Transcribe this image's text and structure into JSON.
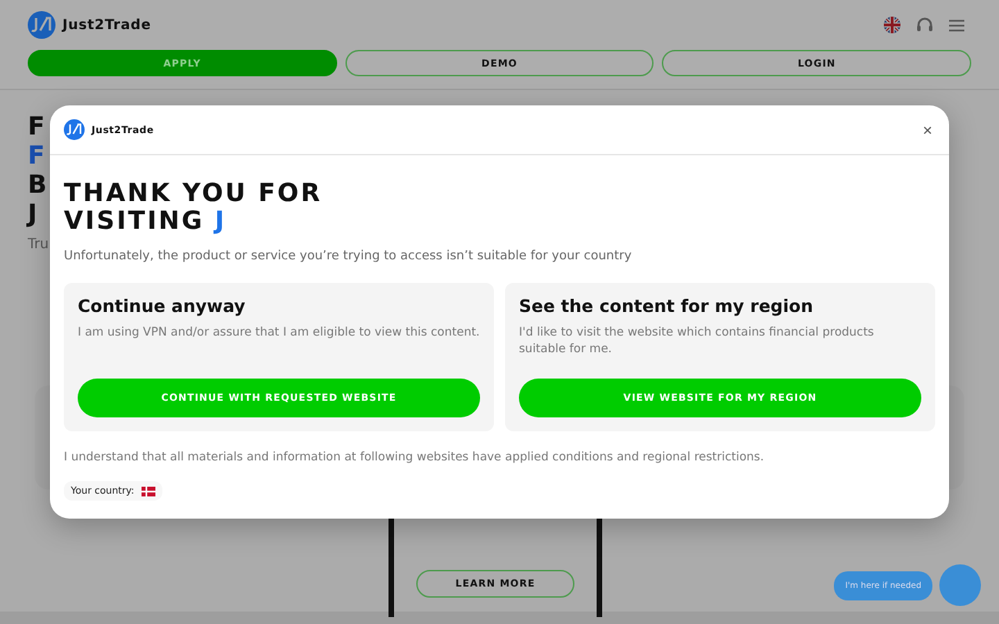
{
  "header": {
    "logo": "Just2Trade",
    "buttons": [
      {
        "label": "APPLY",
        "kind": "filled"
      },
      {
        "label": "DEMO",
        "kind": "outline"
      },
      {
        "label": "LOGIN",
        "kind": "outline"
      }
    ]
  },
  "hero": {
    "lines": [
      {
        "text": "F",
        "accent": false
      },
      {
        "text": "F",
        "accent": true
      },
      {
        "text": "B",
        "accent": false
      },
      {
        "text": "J",
        "accent": false
      }
    ],
    "subtitle": "Tru"
  },
  "learn_more": "LEARN MORE",
  "chat": {
    "bubble": "I'm here if needed"
  },
  "modal": {
    "logo": "Just2Trade",
    "close": "×",
    "title": [
      "THANK YOU FOR",
      "VISITING"
    ],
    "title_accent": "J",
    "subtitle": "Unfortunately, the product or service you’re trying to access isn’t suitable for your country",
    "options": [
      {
        "heading": "Continue anyway",
        "text": "I am using VPN and/or assure that I am eligible to view this content.",
        "button": "CONTINUE WITH REQUESTED WEBSITE"
      },
      {
        "heading": "See the content for my region",
        "text": "I'd like to visit the website which contains financial products suitable for me.",
        "button": "VIEW WEBSITE FOR MY REGION"
      }
    ],
    "note": "I understand that all materials and information at following websites have applied conditions and regional restrictions.",
    "country_label": "Your country:"
  }
}
